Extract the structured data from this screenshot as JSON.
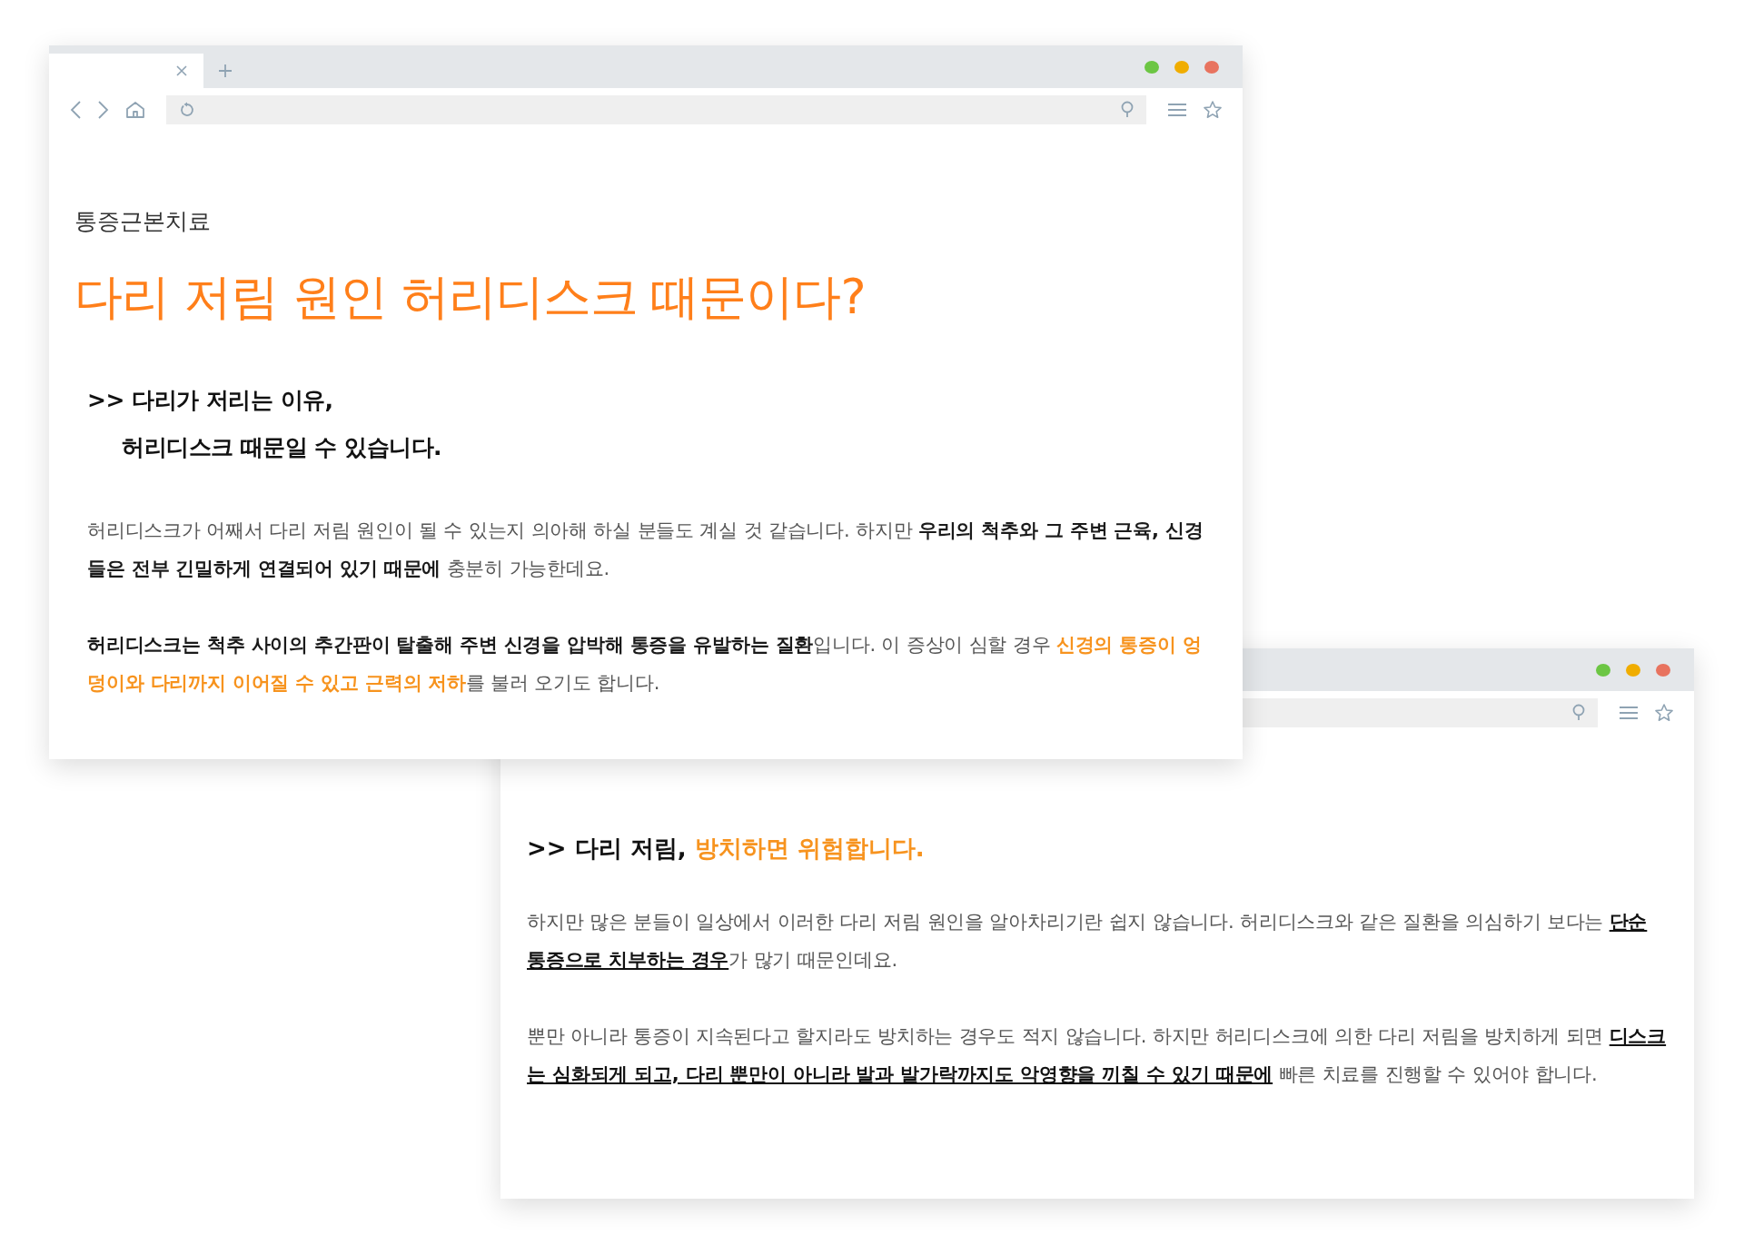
{
  "front_window": {
    "category": "통증근본치료",
    "title": "다리 저림 원인 허리디스크 때문이다?",
    "heading_lines": [
      ">> 다리가 저리는 이유,",
      "허리디스크 때문일 수 있습니다."
    ],
    "paragraphs": [
      [
        {
          "kind": "plain",
          "text": "허리디스크가 어째서 다리 저림 원인이 될 수 있는지 의아해 하실 분들도 계실 것 같습니다. 하지만 "
        },
        {
          "kind": "bold",
          "text": "우리의 척추와 그 주변 근육, 신경들은 전부 긴밀하게 연결되어 있기 때문에"
        },
        {
          "kind": "plain",
          "text": " 충분히 가능한데요."
        }
      ],
      [
        {
          "kind": "bold",
          "text": "허리디스크는 척추 사이의 추간판이 탈출해 주변 신경을 압박해 통증을 유발하는 질환"
        },
        {
          "kind": "plain",
          "text": "입니다. 이 증상이 심할 경우 "
        },
        {
          "kind": "accent",
          "text": "신경의 통증이 엉덩이와 다리까지 이어질 수 있고 근력의 저하"
        },
        {
          "kind": "plain",
          "text": "를 불러 오기도 합니다."
        }
      ]
    ]
  },
  "back_window": {
    "heading": [
      {
        "kind": "heading",
        "text": ">> 다리 저림, "
      },
      {
        "kind": "accent",
        "text": "방치하면 위험합니다."
      }
    ],
    "paragraphs": [
      [
        {
          "kind": "plain",
          "text": "하지만 많은 분들이 일상에서 이러한 다리 저림 원인을 알아차리기란 쉽지 않습니다. 허리디스크와 같은 질환을 의심하기 보다는 "
        },
        {
          "kind": "underline",
          "text": "단순 통증으로 치부하는 경우"
        },
        {
          "kind": "plain",
          "text": "가 많기 때문인데요."
        }
      ],
      [
        {
          "kind": "plain",
          "text": "뿐만 아니라 통증이 지속된다고 할지라도 방치하는 경우도 적지 않습니다. 하지만 허리디스크에 의한 다리 저림을 방치하게 되면 "
        },
        {
          "kind": "underline",
          "text": "디스크는 심화되게 되고, 다리 뿐만이 아니라 발과 발가락까지도 악영향을 끼칠 수 있기 때문에"
        },
        {
          "kind": "plain",
          "text": " 빠른 치료를 진행할 수 있어야 합니다."
        }
      ]
    ]
  }
}
